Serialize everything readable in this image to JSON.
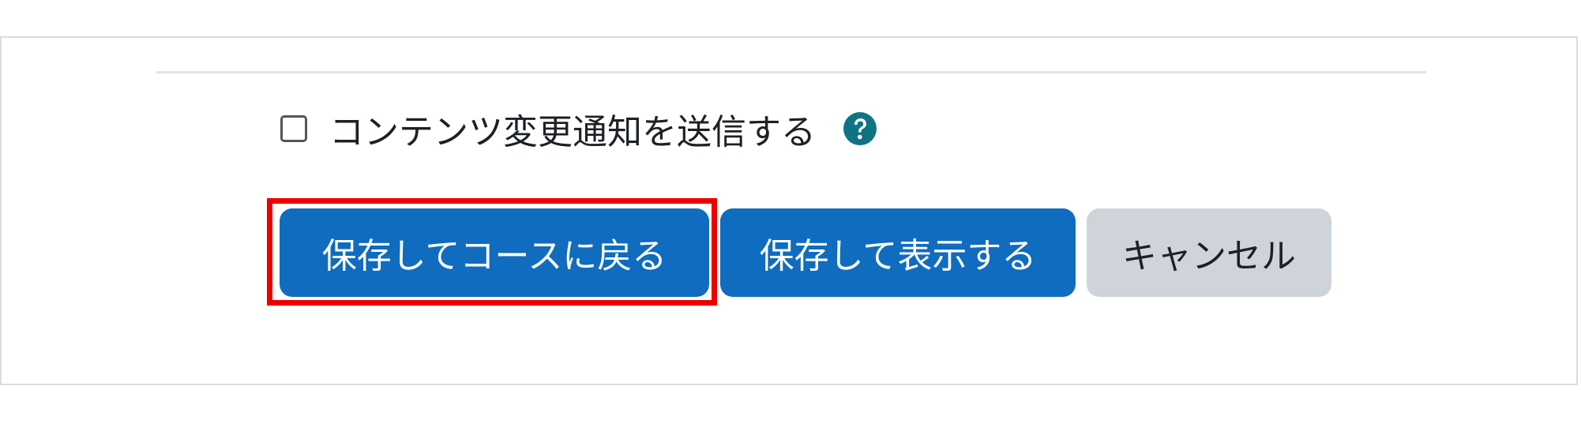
{
  "form": {
    "notify_checkbox": {
      "label": "コンテンツ変更通知を送信する",
      "checked": false,
      "help_icon": "question-circle-icon",
      "help_icon_color": "#0f7481"
    },
    "buttons": {
      "save_return_label": "保存してコースに戻る",
      "save_display_label": "保存して表示する",
      "cancel_label": "キャンセル"
    },
    "colors": {
      "primary": "#0f6cbf",
      "secondary": "#ced4da",
      "highlight": "#ee0000"
    }
  }
}
